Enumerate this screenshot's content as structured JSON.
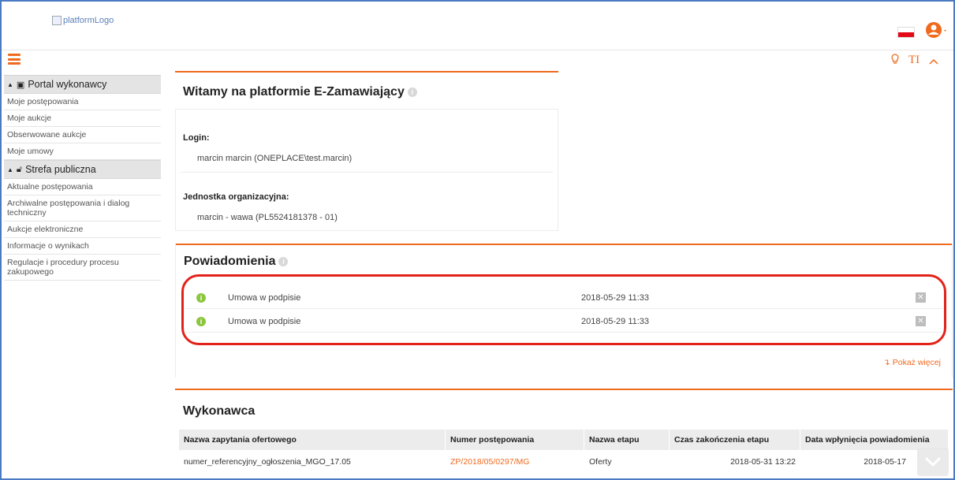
{
  "header": {
    "logo_alt": "platformLogo",
    "flag": "pl-flag",
    "user_icon": "user-icon"
  },
  "colors": {
    "accent": "#f06a1e",
    "highlight": "#e2231a",
    "info_green": "#8cc63e"
  },
  "sidebar": {
    "sections": [
      {
        "title": "Portal wykonawcy",
        "icon": "monitor-icon",
        "items": [
          "Moje postępowania",
          "Moje aukcje",
          "Obserwowane aukcje",
          "Moje umowy"
        ]
      },
      {
        "title": "Strefa publiczna",
        "icon": "unlock-icon",
        "items": [
          "Aktualne postępowania",
          "Archiwalne postępowania i dialog techniczny",
          "Aukcje elektroniczne",
          "Informacje o wynikach",
          "Regulacje i procedury procesu zakupowego"
        ]
      }
    ]
  },
  "toolbar": {
    "tip_icon": "lightbulb-icon",
    "text_size_label": "TI",
    "collapse_icon": "chevron-up-icon"
  },
  "welcome": {
    "title": "Witamy na platformie E-Zamawiający",
    "login_label": "Login:",
    "login_value": "marcin marcin (ONEPLACE\\test.marcin)",
    "unit_label": "Jednostka organizacyjna:",
    "unit_value": "marcin - wawa (PL5524181378 - 01)"
  },
  "notifications": {
    "title": "Powiadomienia",
    "rows": [
      {
        "text": "Umowa w podpisie",
        "date": "2018-05-29 11:33"
      },
      {
        "text": "Umowa w podpisie",
        "date": "2018-05-29 11:33"
      }
    ],
    "show_more": "Pokaż więcej"
  },
  "executor": {
    "title": "Wykonawca",
    "columns": [
      "Nazwa zapytania ofertowego",
      "Numer postępowania",
      "Nazwa etapu",
      "Czas zakończenia etapu",
      "Data wpłynięcia powiadomienia"
    ],
    "rows": [
      [
        "numer_referencyjny_ogłoszenia_MGO_17.05",
        "ZP/2018/05/0297/MG",
        "Oferty",
        "2018-05-31 13:22",
        "2018-05-17"
      ]
    ]
  }
}
